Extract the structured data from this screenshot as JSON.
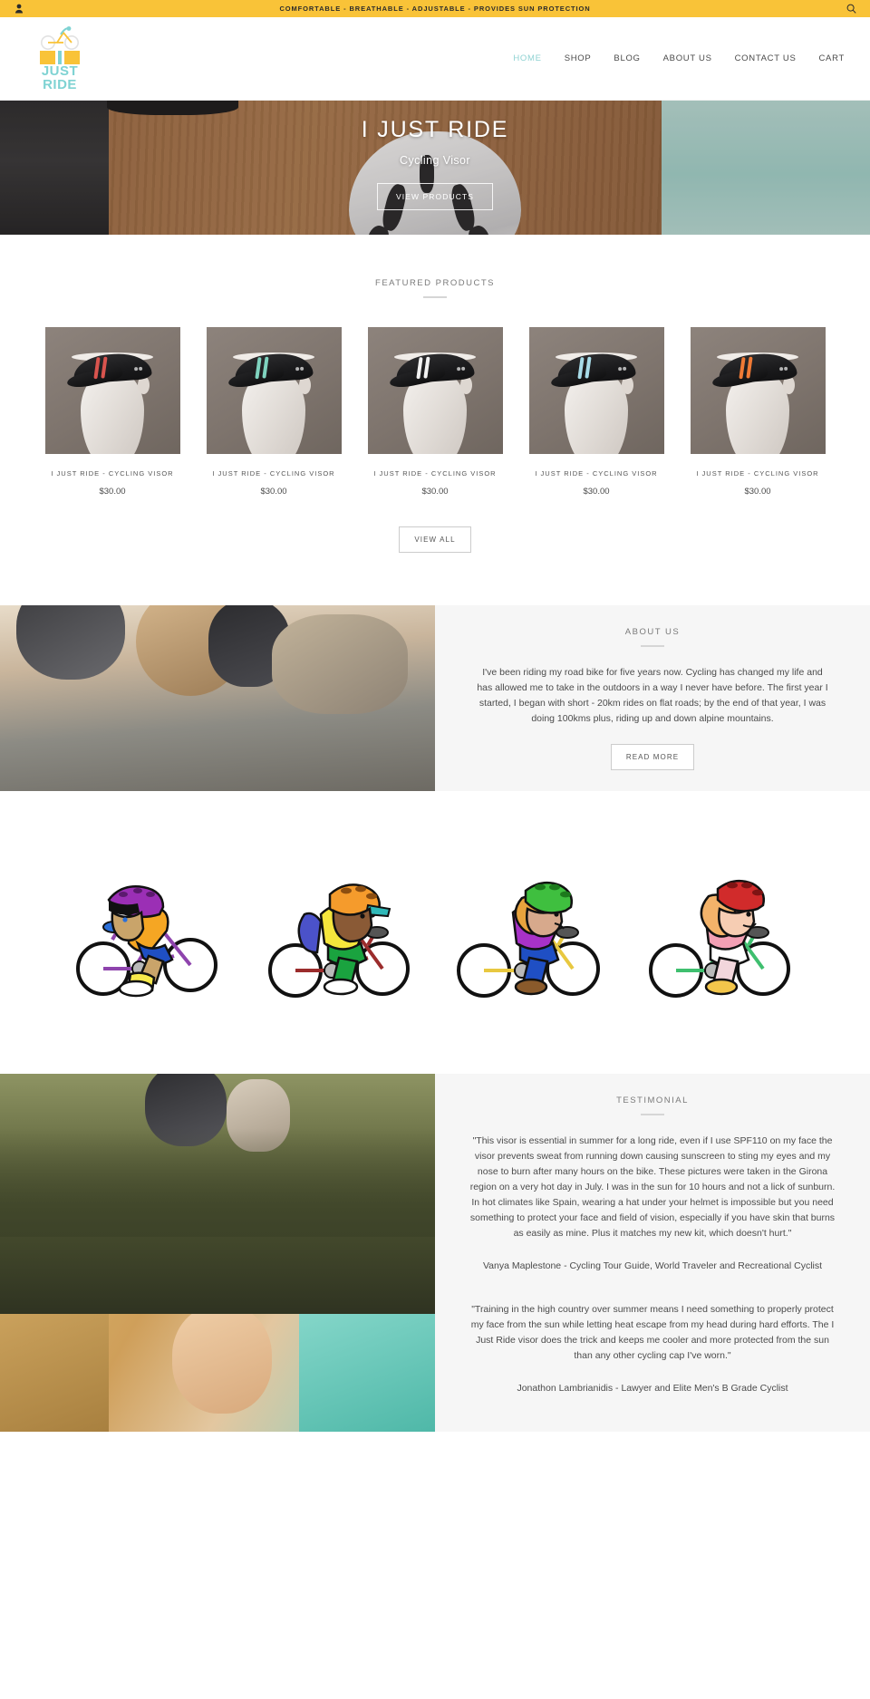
{
  "announcement": {
    "text": "COMFORTABLE - BREATHABLE - ADJUSTABLE - PROVIDES SUN PROTECTION",
    "account_icon": "account-icon",
    "search_icon": "search-icon",
    "background_color": "#f9c338"
  },
  "header": {
    "logo": {
      "word_top": "JUST",
      "word_bottom": "RIDE",
      "brand_teal": "#7fd3d3",
      "brand_yellow": "#f9c338"
    },
    "nav": [
      {
        "label": "HOME",
        "active": true
      },
      {
        "label": "SHOP",
        "active": false
      },
      {
        "label": "BLOG",
        "active": false
      },
      {
        "label": "ABOUT US",
        "active": false
      },
      {
        "label": "CONTACT US",
        "active": false
      },
      {
        "label": "CART",
        "active": false
      }
    ]
  },
  "hero": {
    "title": "I JUST RIDE",
    "subtitle": "Cycling Visor",
    "button": "VIEW PRODUCTS"
  },
  "featured": {
    "heading": "FEATURED PRODUCTS",
    "view_all": "VIEW ALL",
    "products": [
      {
        "name": "I JUST RIDE - CYCLING VISOR",
        "price": "$30.00",
        "stripe_color": "#d9544e"
      },
      {
        "name": "I JUST RIDE - CYCLING VISOR",
        "price": "$30.00",
        "stripe_color": "#7fd3bf"
      },
      {
        "name": "I JUST RIDE - CYCLING VISOR",
        "price": "$30.00",
        "stripe_color": "#f2f2f2"
      },
      {
        "name": "I JUST RIDE - CYCLING VISOR",
        "price": "$30.00",
        "stripe_color": "#a8dce8"
      },
      {
        "name": "I JUST RIDE - CYCLING VISOR",
        "price": "$30.00",
        "stripe_color": "#f07a35"
      }
    ]
  },
  "about": {
    "heading": "ABOUT US",
    "body": "I've been riding my road bike for five years now. Cycling has changed my life and has allowed me to take in the outdoors in a way I never have before. The first year I started, I began with short - 20km rides on flat roads; by the end of that year, I was doing 100kms plus, riding up and down alpine mountains.",
    "button": "READ MORE"
  },
  "cyclists": [
    {
      "name": "cyclist-purple-helmet",
      "helmet": "#9b2fb5",
      "jersey": "#f5a623",
      "shorts": "#1f4fc4",
      "frame": "#8e44ad",
      "shoe": "#f7e94b"
    },
    {
      "name": "cyclist-orange-helmet",
      "helmet": "#f59b2c",
      "jersey": "#f5e63c",
      "shorts": "#1aa33f",
      "frame": "#9b2c2c",
      "shoe": "#ffffff"
    },
    {
      "name": "cyclist-green-helmet",
      "helmet": "#3fbf3f",
      "jersey": "#a832c8",
      "shorts": "#1f4fc4",
      "frame": "#e8c840",
      "shoe": "#8a5a2b"
    },
    {
      "name": "cyclist-red-helmet",
      "helmet": "#d12b2b",
      "jersey": "#f3a0b5",
      "shorts": "#ffffff",
      "frame": "#3fbf6f",
      "shoe": "#f3c64b"
    }
  ],
  "testimonial": {
    "heading": "TESTIMONIAL",
    "entries": [
      {
        "quote": "\"This visor is essential in summer for a long ride, even if I use SPF110 on my face the visor prevents sweat from running down causing sunscreen to sting my eyes and my nose to burn after many hours on the bike. These pictures were taken in the Girona region on a very hot day in July. I was in the sun for 10 hours and not a lick of sunburn. In hot climates like Spain, wearing a hat under your helmet is impossible but you need something to protect your face and field of vision, especially if you have skin that burns as easily as mine. Plus it matches my new kit, which doesn't hurt.\"",
        "author": "Vanya Maplestone - Cycling Tour Guide, World Traveler and Recreational Cyclist"
      },
      {
        "quote": "\"Training in the high country over summer means I need something to properly protect my face from the sun while letting heat escape from my head during hard efforts. The I Just Ride visor does the trick and keeps me cooler and more protected from the sun than any other cycling cap I've worn.\"",
        "author": "Jonathon Lambrianidis - Lawyer and Elite Men's B Grade Cyclist"
      }
    ]
  }
}
